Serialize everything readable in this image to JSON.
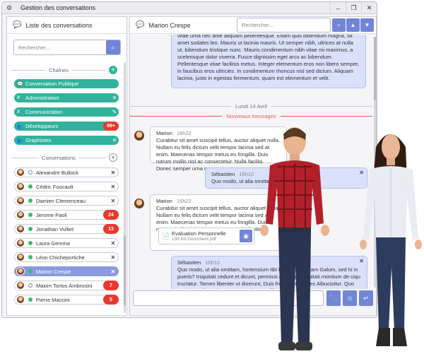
{
  "window": {
    "title": "Gestion des conversations",
    "controls": [
      "–",
      "❐",
      "✕"
    ]
  },
  "left": {
    "header": "Liste des conversations",
    "search_placeholder": "Rechercher...",
    "channels_label": "Chaînes",
    "channels": [
      {
        "icon": "chat-icon",
        "name": "Conversation Publique",
        "action": ""
      },
      {
        "icon": "hash-icon",
        "name": "Administration",
        "action": "✕"
      },
      {
        "icon": "hash-icon",
        "name": "Communication",
        "action": "✎"
      },
      {
        "icon": "group-icon",
        "name": "Développeurs",
        "action": "",
        "badge": "99+"
      },
      {
        "icon": "group-icon",
        "name": "Graphistes",
        "action": "✕"
      }
    ],
    "conversations_label": "Conversations",
    "conversations": [
      {
        "name": "Alexandre Bullock",
        "status": "offline",
        "badge": ""
      },
      {
        "name": "Cédric Foucault",
        "status": "online",
        "badge": ""
      },
      {
        "name": "Damien Clemenceau",
        "status": "online",
        "badge": ""
      },
      {
        "name": "Jerome Paoli",
        "status": "online",
        "badge": "24"
      },
      {
        "name": "Jonathan Vulliet",
        "status": "online",
        "badge": "13"
      },
      {
        "name": "Laura Gemma",
        "status": "online",
        "badge": ""
      },
      {
        "name": "Léon Chicheportiche",
        "status": "online",
        "badge": ""
      },
      {
        "name": "Marion Crespe",
        "status": "online",
        "badge": "",
        "selected": true
      },
      {
        "name": "Maxim Tortos Ambrosini",
        "status": "offline",
        "badge": "7"
      },
      {
        "name": "Pierre Maccini",
        "status": "online",
        "badge": "5"
      }
    ]
  },
  "right": {
    "header": "Marion Crespe",
    "search_placeholder": "Rechercher...",
    "first_body": "vitae urna nec ante aliquam pellentesque. Etiam quis bibendum magna, sit amet sodales leo. Mauris ut lacinia mauris. Ut semper nibh, ultrices at nulla ut, bibendum tristique nunc. Mauris condimentum nibh vitae mi maximus, a scelerisque dolor viverra. Fusce dignissim eget arcu ac bibendum. Pellentesque vitae facilisis metus. Integer elementum eros non libero semper, in faucibus eros ultricies. In condimentum rhoncus nisl sed dictum. Aliquam lacinia, justo in egestas fermentum, quam est elementum et velit.",
    "date_divider": "Lundi 14 Avril",
    "new_divider": "Nouveaux messages",
    "messages": [
      {
        "who": "Marion",
        "time": "16h22",
        "body": "Curabitur sit amet suscipit tellus, auctor aliquet nulla. Nullam eu felis dictum velit tempor lacinia sed at enim. Maecenas tempor metus eu fringilla. Duis rutrum mollis nisl ac consectetur. Nulla facilisi. Donec semper urna non"
      },
      {
        "who": "Sébastien",
        "time": "16h10",
        "body": "Quo modo, ut alia omittam, per memineram."
      },
      {
        "who": "Marion",
        "time": "16h22",
        "body": "Curabitur sit amet suscipit tellus, auctor aliquet nulla. Nullam eu felis dictum velit tempor lacinia sed at enim. Maecenas tempor metus eu fringilla. Duis rutrum mollis nisl ac consectetur. Nulla facilisi."
      },
      {
        "who": "Sébastien",
        "time": "16h10",
        "body": "Quo modo, ut alia omittam, hortensium tibi Paulum, videram Galum, sed hi in pueris? Iniquitati cedunt et dicunt, permissi deinceps inquitati montium de ciqu tructatur. Tamen libenter ut dixerunt, Duis fruatur atque nec Albucioitur. Quo modo, ut alia omittam, per memineram fili tuli!"
      }
    ],
    "file": {
      "name": "Evaluation Personnelle",
      "size": "138 Kb Document pdf"
    }
  },
  "colors": {
    "accent": "#7385d6",
    "channel": "#30b39a",
    "badge": "#e8392e",
    "date_line": "#c8c8d0",
    "new_line": "#e85a4f"
  }
}
